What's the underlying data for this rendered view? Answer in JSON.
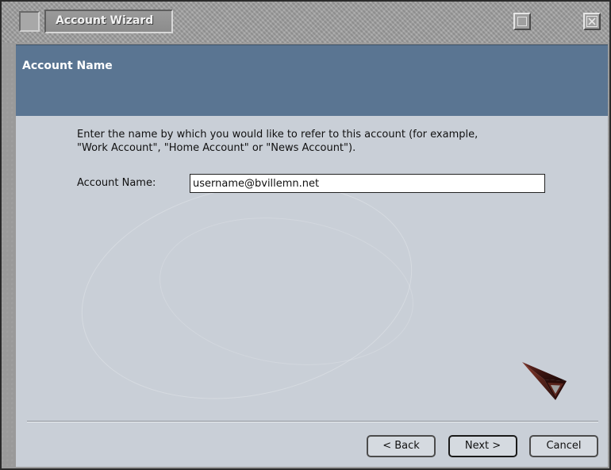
{
  "window": {
    "title": "Account Wizard"
  },
  "header": {
    "title": "Account Name"
  },
  "instructions": {
    "line1": "Enter the name by which you would like to refer to this account (for example,",
    "line2": "\"Work Account\", \"Home Account\" or \"News Account\")."
  },
  "account_name": {
    "label": "Account Name:",
    "value": "username@bvillemn.net"
  },
  "buttons": {
    "back": "< Back",
    "next": "Next >",
    "cancel": "Cancel"
  },
  "colors": {
    "header_band": "#5a7592",
    "content_bg": "#c9cfd7"
  },
  "icons": {
    "window_system": "system-menu-icon",
    "maximize": "maximize-icon",
    "close": "close-icon",
    "logo": "netscape-logo-icon"
  }
}
